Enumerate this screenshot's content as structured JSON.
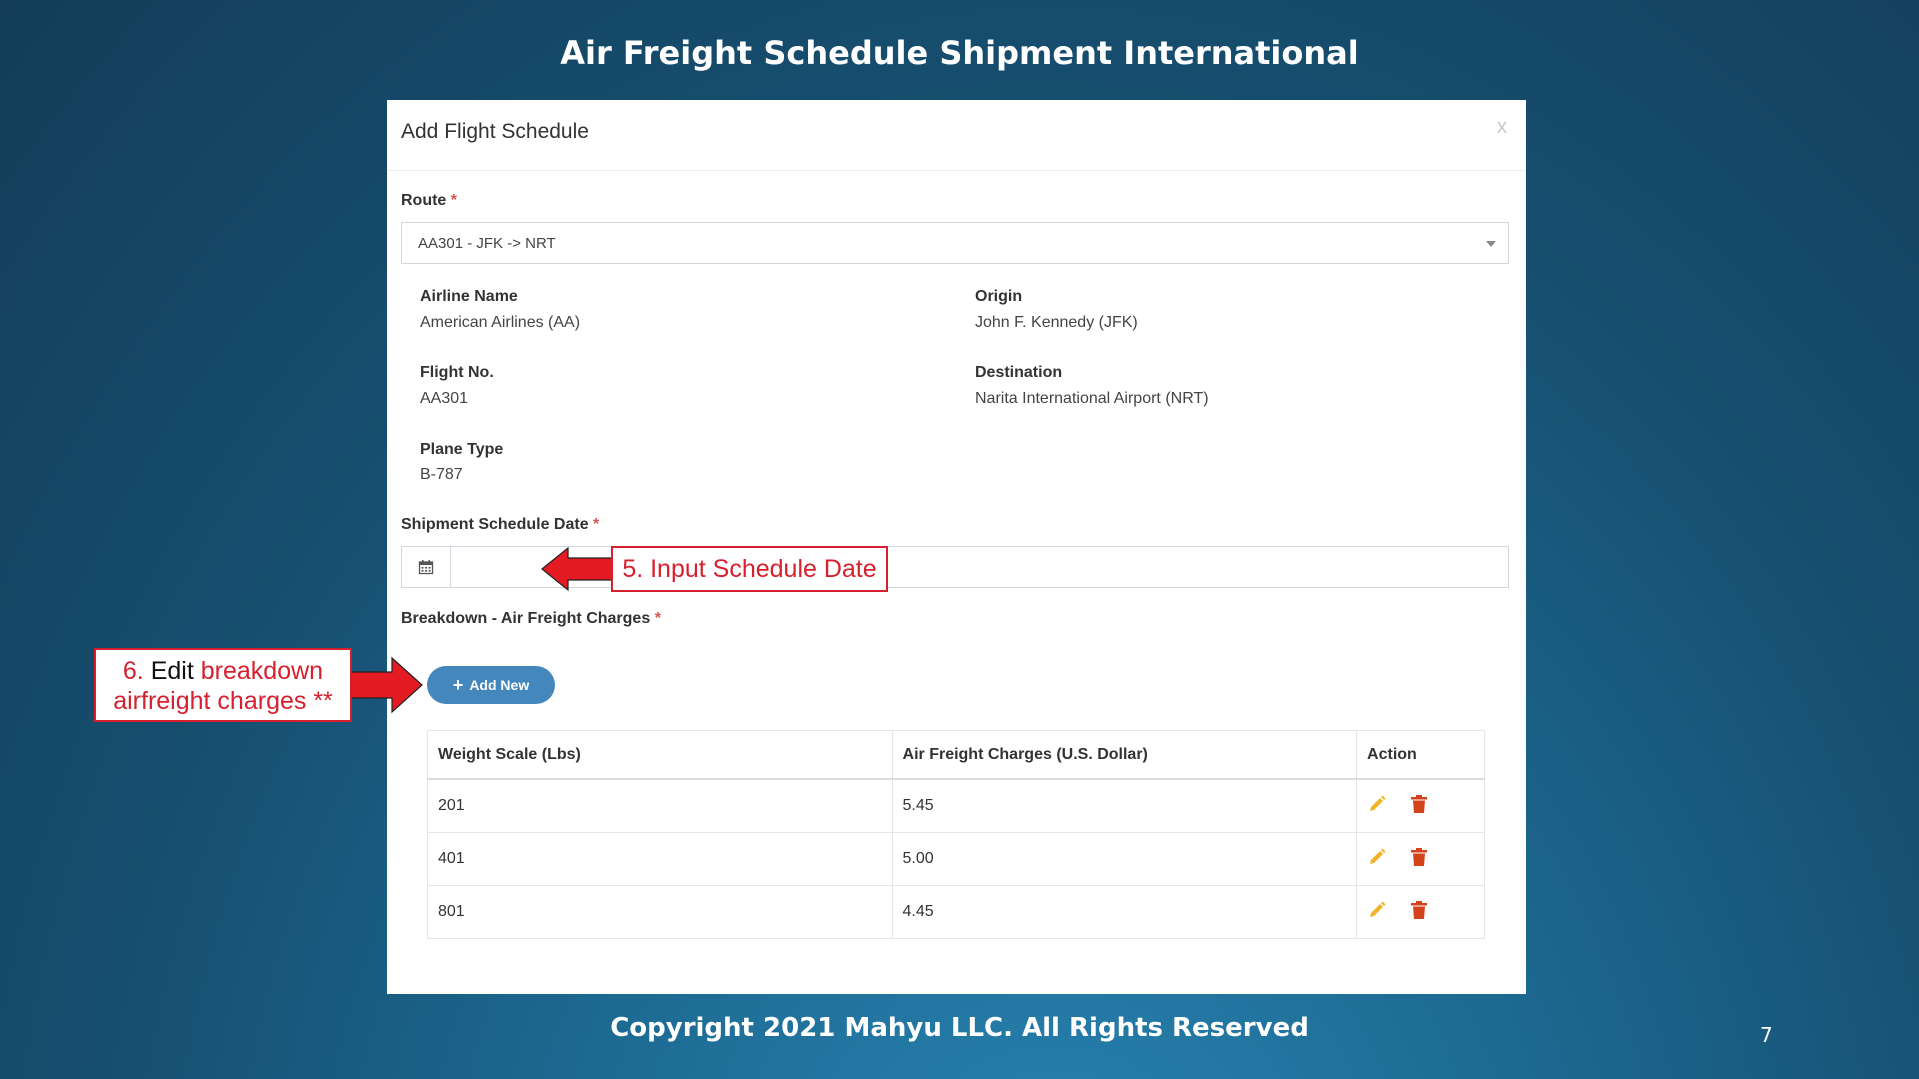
{
  "slide": {
    "title": "Air Freight Schedule Shipment International",
    "copyright": "Copyright 2021 Mahyu LLC. All Rights Reserved",
    "page_number": "7"
  },
  "modal": {
    "title": "Add Flight Schedule",
    "close_label": "x",
    "route": {
      "label": "Route",
      "required_mark": "*",
      "selected": "AA301 - JFK -> NRT"
    },
    "details": {
      "airline_name_label": "Airline Name",
      "airline_name_value": "American Airlines (AA)",
      "origin_label": "Origin",
      "origin_value": "John F. Kennedy (JFK)",
      "flight_no_label": "Flight No.",
      "flight_no_value": "AA301",
      "destination_label": "Destination",
      "destination_value": "Narita International Airport (NRT)",
      "plane_type_label": "Plane Type",
      "plane_type_value": "B-787"
    },
    "schedule_date": {
      "label": "Shipment Schedule Date",
      "required_mark": "*",
      "value": ""
    },
    "breakdown": {
      "label": "Breakdown - Air Freight Charges",
      "required_mark": "*",
      "add_button_label": "Add New",
      "columns": [
        "Weight Scale (Lbs)",
        "Air Freight Charges (U.S. Dollar)",
        "Action"
      ],
      "rows": [
        {
          "weight": "201",
          "charge": "5.45"
        },
        {
          "weight": "401",
          "charge": "5.00"
        },
        {
          "weight": "801",
          "charge": "4.45"
        }
      ]
    }
  },
  "annotations": {
    "step5": "5. Input Schedule Date",
    "step6_number": "6.",
    "step6_black": "Edit",
    "step6_red_line1": "breakdown",
    "step6_red_line2": "airfreight charges **"
  },
  "colors": {
    "accent_button": "#4387bd",
    "edit_icon": "#f0b429",
    "delete_icon": "#d4441c",
    "callout_red": "#d6202e",
    "required": "#d9534f"
  },
  "icons": {
    "calendar": "calendar-icon",
    "edit": "pencil-icon",
    "delete": "trash-icon",
    "add": "plus-icon",
    "dropdown": "chevron-down-icon"
  }
}
